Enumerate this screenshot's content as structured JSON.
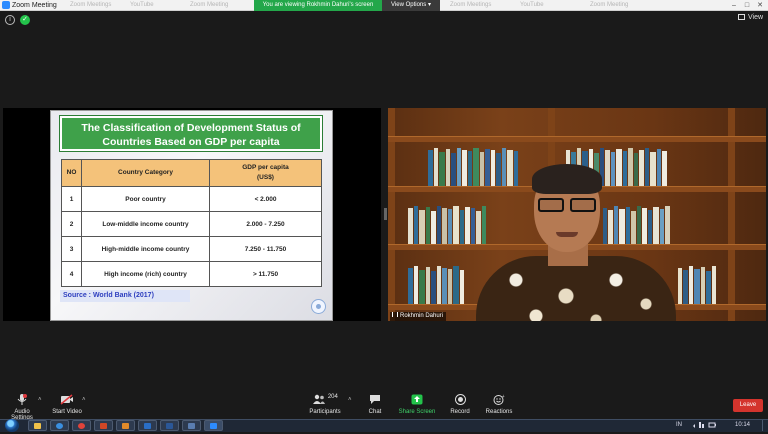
{
  "window": {
    "title": "Zoom Meeting",
    "share_banner": "You are viewing Rokhmin Dahuri's screen",
    "view_options": "View Options",
    "view_options_caret": "▾",
    "background_tabs": [
      "Zoom Meetings",
      "YouTube",
      "Zoom Meeting"
    ],
    "controls": {
      "minimize": "–",
      "maximize": "□",
      "close": "✕"
    }
  },
  "meeting_bar": {
    "info_icon": "i",
    "shield_icon": "✓",
    "view_label": "View"
  },
  "slide": {
    "title_line1": "The Classification of Development Status of",
    "title_line2": "Countries Based on GDP per capita",
    "table": {
      "headers": {
        "no": "NO",
        "category": "Country Category",
        "gdp": "GDP per capita",
        "gdp_unit": "(US$)"
      },
      "rows": [
        {
          "no": "1",
          "category": "Poor country",
          "gdp": "< 2.000"
        },
        {
          "no": "2",
          "category": "Low-middle income country",
          "gdp": "2.000 - 7.250"
        },
        {
          "no": "3",
          "category": "High-middle income country",
          "gdp": "7.250 - 11.750"
        },
        {
          "no": "4",
          "category": "High income (rich) country",
          "gdp": "> 11.750"
        }
      ]
    },
    "source": "Source : World Bank (2017)"
  },
  "video": {
    "participant_name": "Rokhmin Dahuri"
  },
  "toolbar": {
    "audio_label": "Audio Settings",
    "video_label": "Start Video",
    "participants_label": "Participants",
    "participants_count": "204",
    "chat_label": "Chat",
    "share_label": "Share Screen",
    "record_label": "Record",
    "reactions_label": "Reactions",
    "leave_label": "Leave",
    "caret": "˄"
  },
  "taskbar": {
    "language": "IN",
    "time": "10:14"
  },
  "colors": {
    "share_banner": "#23a74a",
    "slide_title_bg": "#3fa14a",
    "table_header_bg": "#f4c27a",
    "source_text": "#2e3fbf",
    "leave_button": "#d4342d"
  }
}
